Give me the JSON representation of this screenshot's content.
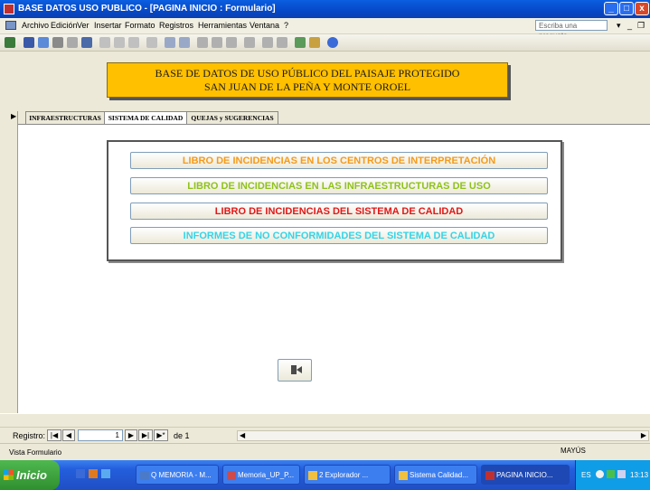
{
  "window": {
    "title": "BASE DATOS USO PUBLICO - [PAGINA INICIO : Formulario]",
    "controls": {
      "minimize": "_",
      "maximize": "□",
      "close": "x"
    }
  },
  "menubar": {
    "items": [
      "Archivo",
      "Edición",
      "Ver",
      "Insertar",
      "Formato",
      "Registros",
      "Herramientas",
      "Ventana",
      "?"
    ],
    "ask_placeholder": "Escriba una pregunta"
  },
  "header": {
    "line1": "BASE DE DATOS DE USO PÚBLICO DEL PAISAJE PROTEGIDO",
    "line2": "SAN JUAN DE LA PEÑA Y MONTE OROEL"
  },
  "tabs": [
    {
      "label": "INFRAESTRUCTURAS"
    },
    {
      "label": "SISTEMA DE CALIDAD"
    },
    {
      "label": "QUEJAS y SUGERENCIAS"
    }
  ],
  "buttons": [
    {
      "label": "LIBRO DE INCIDENCIAS EN LOS CENTROS DE INTERPRETACIÓN",
      "color": "#f59a1a"
    },
    {
      "label": "LIBRO DE INCIDENCIAS EN LAS INFRAESTRUCTURAS DE USO",
      "color": "#8fc21a"
    },
    {
      "label": "LIBRO DE INCIDENCIAS DEL SISTEMA DE CALIDAD",
      "color": "#e01818"
    },
    {
      "label": "INFORMES DE NO CONFORMIDADES DEL SISTEMA DE CALIDAD",
      "color": "#34d4e8"
    }
  ],
  "exit_icon": "exit-door-icon",
  "record_nav": {
    "label": "Registro:",
    "current": "1",
    "of_text": "de 1"
  },
  "status": {
    "left": "Vista Formulario",
    "caps": "MAYÚS"
  },
  "taskbar": {
    "start": "Inicio",
    "items": [
      "Q MEMORIA - M...",
      "Memoria_UP_P...",
      "2 Explorador ...",
      "Sistema Calidad...",
      "PAGINA INICIO..."
    ],
    "lang": "ES",
    "time": "13:13"
  }
}
